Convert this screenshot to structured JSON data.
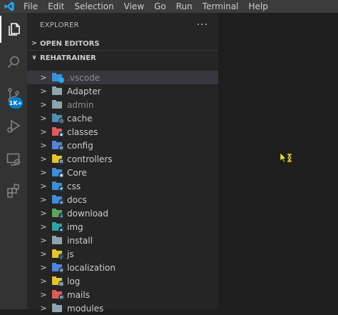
{
  "menu": [
    "File",
    "Edit",
    "Selection",
    "View",
    "Go",
    "Run",
    "Terminal",
    "Help"
  ],
  "activity": {
    "items": [
      {
        "icon": "files-icon"
      },
      {
        "icon": "search-icon"
      },
      {
        "icon": "source-control-icon",
        "badge": "1K+"
      },
      {
        "icon": "run-debug-icon"
      },
      {
        "icon": "remote-explorer-icon"
      },
      {
        "icon": "extensions-icon"
      }
    ]
  },
  "sidebar": {
    "title": "EXPLORER",
    "more": "···",
    "open_editors": "OPEN EDITORS",
    "project": "REHATRAINER"
  },
  "tree": [
    {
      "label": ".vscode",
      "color": "#3c8fd6",
      "overlay": "vscode",
      "dim": true,
      "selected": true
    },
    {
      "label": "Adapter",
      "color": "#90a4ae"
    },
    {
      "label": "admin",
      "color": "#90a4ae",
      "dim": true
    },
    {
      "label": "cache",
      "color": "#4e8fb0",
      "overlay": "clock"
    },
    {
      "label": "classes",
      "color": "#e05b5b",
      "overlay": "box"
    },
    {
      "label": "config",
      "color": "#4f86d9",
      "overlay": "gear"
    },
    {
      "label": "controllers",
      "color": "#e6c42b",
      "overlay": "gear"
    },
    {
      "label": "Core",
      "color": "#3c8fd6",
      "overlay": "ring"
    },
    {
      "label": "css",
      "color": "#3c8fd6",
      "overlay": "css"
    },
    {
      "label": "docs",
      "color": "#3c8fd6",
      "overlay": "doc"
    },
    {
      "label": "download",
      "color": "#5ea35e",
      "overlay": "down"
    },
    {
      "label": "img",
      "color": "#2fa3a3",
      "overlay": "img"
    },
    {
      "label": "install",
      "color": "#90a4ae"
    },
    {
      "label": "js",
      "color": "#e6c42b",
      "overlay": "js"
    },
    {
      "label": "localization",
      "color": "#4f86d9",
      "overlay": "globe"
    },
    {
      "label": "log",
      "color": "#e6c42b",
      "overlay": "log"
    },
    {
      "label": "mails",
      "color": "#e05b5b",
      "overlay": "mail"
    },
    {
      "label": "modules",
      "color": "#90a4ae"
    }
  ],
  "colors": {
    "accent": "#007acc",
    "menubar": "#3c3c3c",
    "activitybar": "#333333",
    "sidebar": "#252526",
    "editor": "#1e1e1e"
  }
}
